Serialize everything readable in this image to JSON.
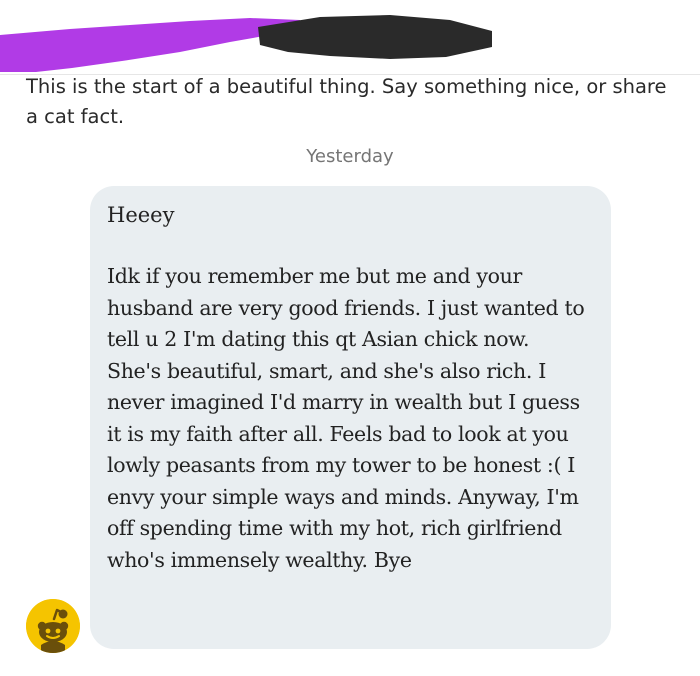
{
  "chat": {
    "intro": "This is the start of a beautiful thing. Say something nice, or share a cat fact.",
    "date_divider": "Yesterday"
  },
  "message": {
    "greeting": "Heeey",
    "body": "Idk if you remember me but me and your husband are very good friends. I just wanted to tell u 2 I'm dating this qt Asian chick now. She's beautiful, smart, and she's also rich. I never imagined I'd marry in wealth but I guess it is my faith after all. Feels bad to look at you lowly peasants from my tower to be honest :( I envy your simple ways and minds. Anyway, I'm off spending time with my hot, rich girlfriend who's immensely wealthy. Bye"
  },
  "colors": {
    "bubble_background": "#e9eef1",
    "avatar_background": "#f5c400",
    "purple_redaction": "#b13be6",
    "dark_redaction": "#2a2a2a"
  },
  "icons": {
    "avatar": "snoo-avatar-icon"
  }
}
